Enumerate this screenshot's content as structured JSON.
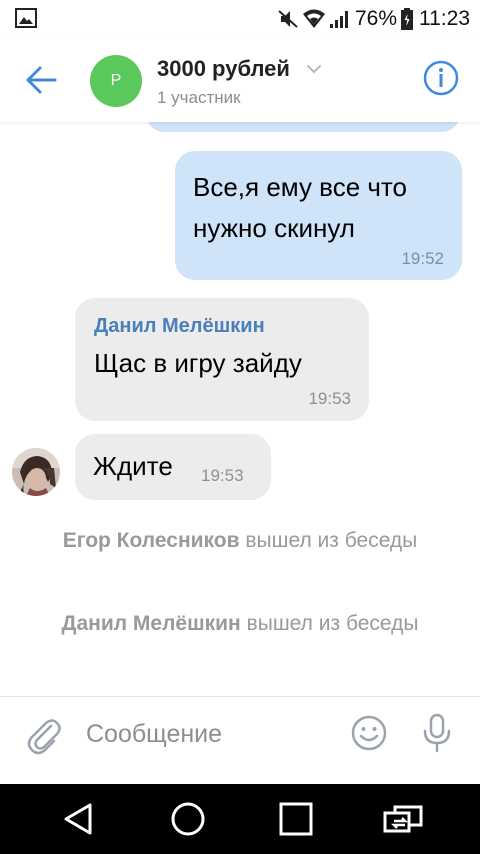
{
  "status_bar": {
    "battery_percent": "76%",
    "time": "11:23",
    "icons": [
      "gallery-icon",
      "mute-icon",
      "wifi-icon",
      "signal-icon",
      "battery-icon"
    ]
  },
  "header": {
    "avatar_letter": "Р",
    "title": "3000 рублей",
    "subtitle": "1 участник",
    "icons": [
      "back-arrow-icon",
      "chevron-down-icon",
      "info-icon"
    ],
    "accent_color": "#3f8ae0"
  },
  "messages": [
    {
      "type": "outgoing",
      "text": "Все,я ему все что нужно скинул",
      "time": "19:52"
    },
    {
      "type": "incoming",
      "author": "Данил Мелёшкин",
      "text": "Щас в игру зайду",
      "time": "19:53"
    },
    {
      "type": "incoming",
      "text": "Ждите",
      "time": "19:53"
    }
  ],
  "service_messages": [
    {
      "name": "Егор Колесников",
      "action": "вышел из беседы"
    },
    {
      "name": "Данил Мелёшкин",
      "action": "вышел из беседы"
    }
  ],
  "composer": {
    "placeholder": "Сообщение",
    "icons": [
      "paperclip-icon",
      "smile-icon",
      "microphone-icon"
    ]
  },
  "nav_bar": {
    "icons": [
      "nav-back-icon",
      "nav-home-icon",
      "nav-recents-icon",
      "nav-switch-icon"
    ]
  },
  "colors": {
    "outgoing_bubble": "#cfe3f9",
    "incoming_bubble": "#ececec",
    "author_name": "#4a7fb9",
    "avatar_green": "#5ac85a"
  }
}
